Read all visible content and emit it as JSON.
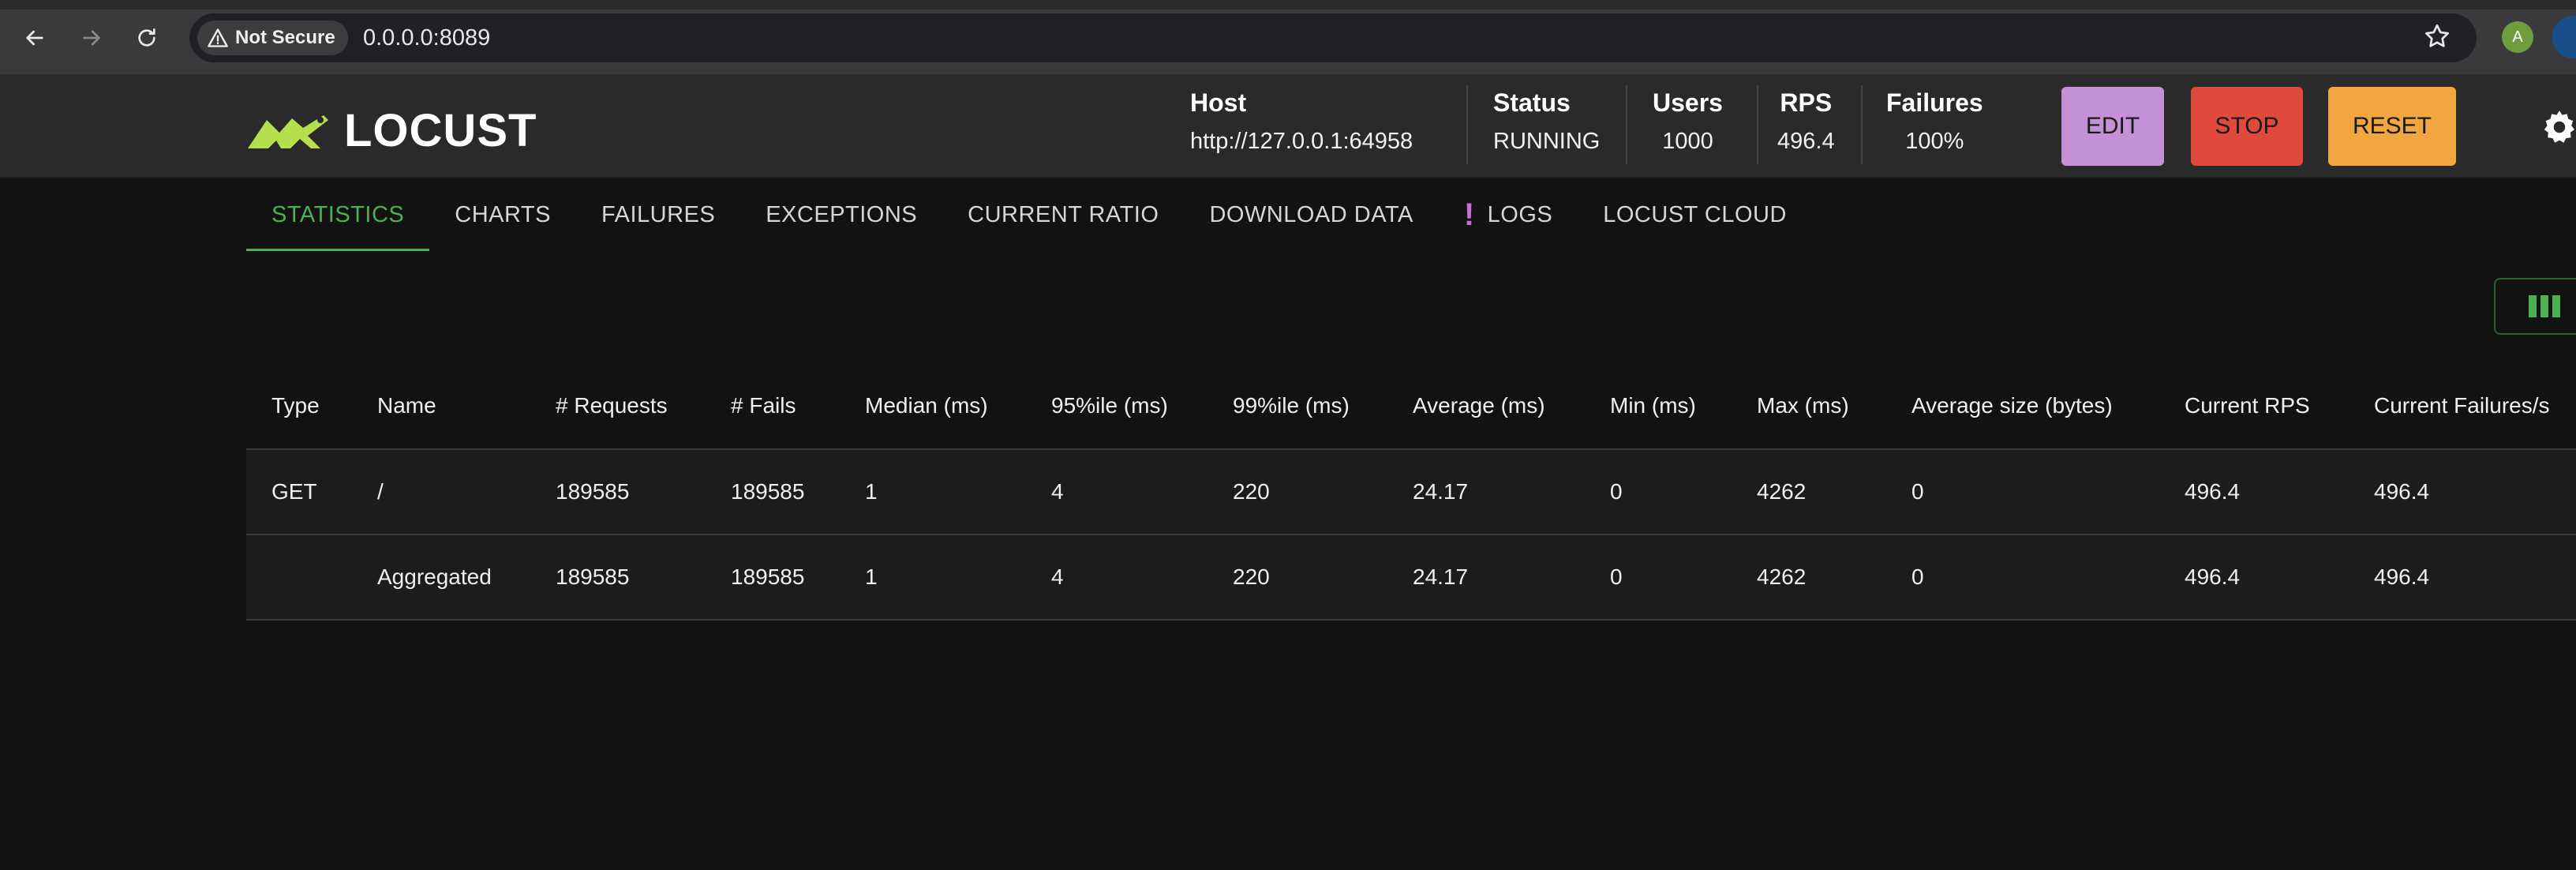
{
  "browser": {
    "security_label": "Not Secure",
    "url": "0.0.0.0:8089",
    "extension_badge": "A"
  },
  "header": {
    "logo_text": "LOCUST",
    "host_label": "Host",
    "host_value": "http://127.0.0.1:64958",
    "status_label": "Status",
    "status_value": "RUNNING",
    "users_label": "Users",
    "users_value": "1000",
    "rps_label": "RPS",
    "rps_value": "496.4",
    "failures_label": "Failures",
    "failures_value": "100%",
    "edit_label": "EDIT",
    "stop_label": "STOP",
    "reset_label": "RESET",
    "colors": {
      "edit": "#c591d6",
      "stop": "#e04a3c",
      "reset": "#f2a640",
      "accent": "#4caf50"
    }
  },
  "tabs": [
    {
      "label": "STATISTICS"
    },
    {
      "label": "CHARTS"
    },
    {
      "label": "FAILURES"
    },
    {
      "label": "EXCEPTIONS"
    },
    {
      "label": "CURRENT RATIO"
    },
    {
      "label": "DOWNLOAD DATA"
    },
    {
      "label": "LOGS",
      "icon": "exclamation-icon"
    },
    {
      "label": "LOCUST CLOUD"
    }
  ],
  "table": {
    "columns": [
      "Type",
      "Name",
      "# Requests",
      "# Fails",
      "Median (ms)",
      "95%ile (ms)",
      "99%ile (ms)",
      "Average (ms)",
      "Min (ms)",
      "Max (ms)",
      "Average size (bytes)",
      "Current RPS",
      "Current Failures/s"
    ],
    "rows": [
      [
        "GET",
        "/",
        "189585",
        "189585",
        "1",
        "4",
        "220",
        "24.17",
        "0",
        "4262",
        "0",
        "496.4",
        "496.4"
      ],
      [
        "",
        "Aggregated",
        "189585",
        "189585",
        "1",
        "4",
        "220",
        "24.17",
        "0",
        "4262",
        "0",
        "496.4",
        "496.4"
      ]
    ]
  }
}
